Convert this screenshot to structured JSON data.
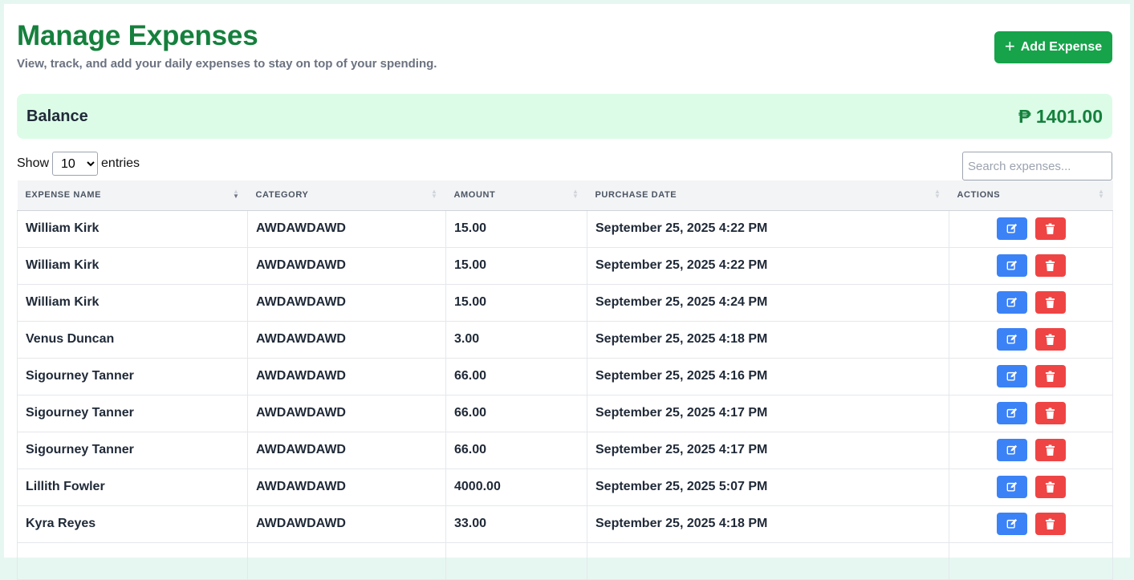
{
  "header": {
    "title": "Manage Expenses",
    "subtitle": "View, track, and add your daily expenses to stay on top of your spending.",
    "add_button": "Add Expense"
  },
  "balance": {
    "label": "Balance",
    "value": "₱ 1401.00"
  },
  "controls": {
    "show_label": "Show",
    "entries_label": "entries",
    "page_size": "10",
    "search_placeholder": "Search expenses..."
  },
  "table": {
    "columns": [
      "EXPENSE NAME",
      "CATEGORY",
      "AMOUNT",
      "PURCHASE DATE",
      "ACTIONS"
    ],
    "rows": [
      [
        "William Kirk",
        "AWDAWDAWD",
        "15.00",
        "September 25, 2025 4:22 PM"
      ],
      [
        "William Kirk",
        "AWDAWDAWD",
        "15.00",
        "September 25, 2025 4:22 PM"
      ],
      [
        "William Kirk",
        "AWDAWDAWD",
        "15.00",
        "September 25, 2025 4:24 PM"
      ],
      [
        "Venus Duncan",
        "AWDAWDAWD",
        "3.00",
        "September 25, 2025 4:18 PM"
      ],
      [
        "Sigourney Tanner",
        "AWDAWDAWD",
        "66.00",
        "September 25, 2025 4:16 PM"
      ],
      [
        "Sigourney Tanner",
        "AWDAWDAWD",
        "66.00",
        "September 25, 2025 4:17 PM"
      ],
      [
        "Sigourney Tanner",
        "AWDAWDAWD",
        "66.00",
        "September 25, 2025 4:17 PM"
      ],
      [
        "Lillith Fowler",
        "AWDAWDAWD",
        "4000.00",
        "September 25, 2025 5:07 PM"
      ],
      [
        "Kyra Reyes",
        "AWDAWDAWD",
        "33.00",
        "September 25, 2025 4:18 PM"
      ],
      [
        "",
        "",
        "",
        ""
      ]
    ],
    "row_actions": [
      "edit-icon",
      "trash-icon"
    ]
  },
  "colors": {
    "title": "#15803d",
    "add_button": "#16a34a",
    "balance_bg": "#dcfce7",
    "edit_button": "#3b82f6",
    "delete_button": "#ef4444"
  }
}
